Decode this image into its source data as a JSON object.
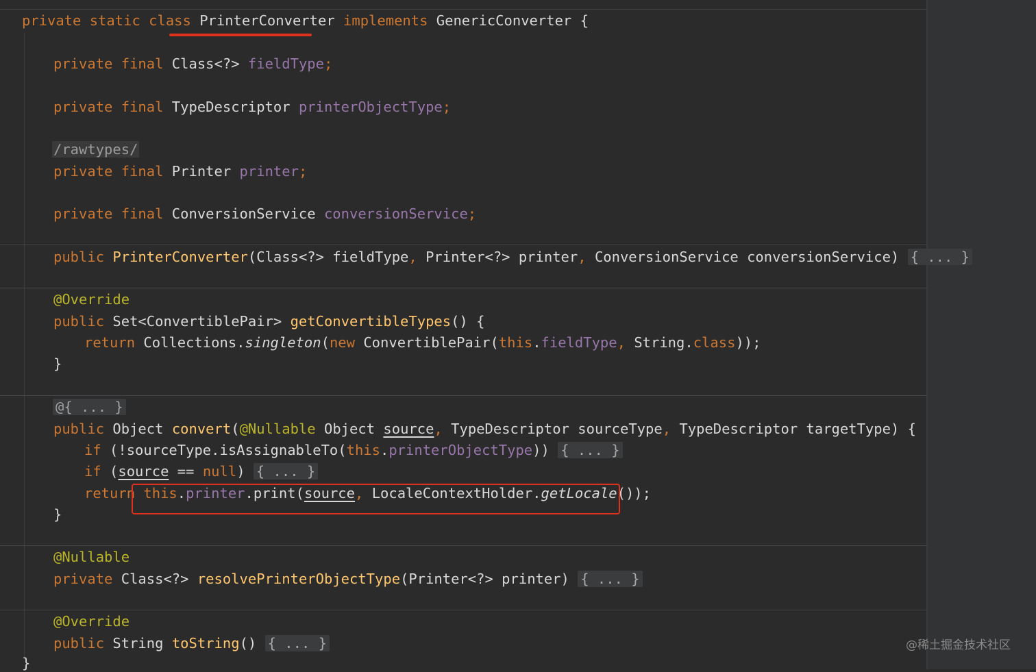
{
  "code": {
    "l1": {
      "a": "private static class ",
      "b": "PrinterConverter",
      "c": " implements ",
      "d": "GenericConverter {"
    },
    "l2": {
      "a": "private final ",
      "b": "Class<?> ",
      "c": "fieldType",
      ";": ";"
    },
    "l3": {
      "a": "private final ",
      "b": "TypeDescriptor ",
      "c": "printerObjectType",
      ";": ";"
    },
    "l4": {
      "a": "/rawtypes/"
    },
    "l5": {
      "a": "private final ",
      "b": "Printer ",
      "c": "printer",
      ";": ";"
    },
    "l6": {
      "a": "private final ",
      "b": "ConversionService ",
      "c": "conversionService",
      ";": ";"
    },
    "l7": {
      "a": "public ",
      "b": "PrinterConverter",
      "c": "(Class<?> fieldType",
      ",1": ", ",
      "d": "Printer<?> printer",
      ",2": ", ",
      "e": "ConversionService conversionService) ",
      "f": "{ ... }"
    },
    "l8": {
      "a": "@Override"
    },
    "l9": {
      "a": "public ",
      "b": "Set<ConvertiblePair> ",
      "c": "getConvertibleTypes",
      "d": "() {"
    },
    "l10": {
      "a": "return ",
      "b": "Collections.",
      "c": "singleton",
      "d": "(",
      "e": "new ",
      "f": "ConvertiblePair(",
      "g": "this",
      ".1": ".",
      "h": "fieldType",
      ",1": ", ",
      "i": "String.",
      "j": "class",
      "k": "));"
    },
    "l11": {
      "a": "}"
    },
    "l12": {
      "a": "@{ ... }"
    },
    "l13": {
      "a": "public ",
      "b": "Object ",
      "c": "convert",
      "d": "(",
      "e": "@Nullable ",
      "f": "Object ",
      "g": "source",
      ",1": ", ",
      "h": "TypeDescriptor sourceType",
      ",2": ", ",
      "i": "TypeDescriptor targetType) {"
    },
    "l14": {
      "a": "if ",
      "b": "(!sourceType.isAssignableTo(",
      "c": "this",
      ".1": ".",
      "d": "printerObjectType",
      "e": ")) ",
      "f": "{ ... }"
    },
    "l15": {
      "a": "if ",
      "b": "(",
      "c": "source",
      "d": " == ",
      "e": "null",
      "f": ") ",
      "g": "{ ... }"
    },
    "l16": {
      "a": "return ",
      "b": "this",
      ".1": ".",
      "c": "printer",
      "d": ".print(",
      "e": "source",
      ",1": ", ",
      "f": "LocaleContextHolder.",
      "g": "getLocale",
      "h": "());"
    },
    "l17": {
      "a": "}"
    },
    "l18": {
      "a": "@Nullable"
    },
    "l19": {
      "a": "private ",
      "b": "Class<?> ",
      "c": "resolvePrinterObjectType",
      "d": "(Printer<?> printer) ",
      "e": "{ ... }"
    },
    "l20": {
      "a": "@Override"
    },
    "l21": {
      "a": "public ",
      "b": "String ",
      "c": "toString",
      "d": "() ",
      "e": "{ ... }"
    },
    "l22": {
      "a": "}"
    }
  },
  "watermark": "@稀土掘金技术社区",
  "colors": {
    "keyword": "#cc7832",
    "field": "#9876aa",
    "method": "#ffc66d",
    "annotation": "#bbb529",
    "highlight": "#e0301e"
  }
}
